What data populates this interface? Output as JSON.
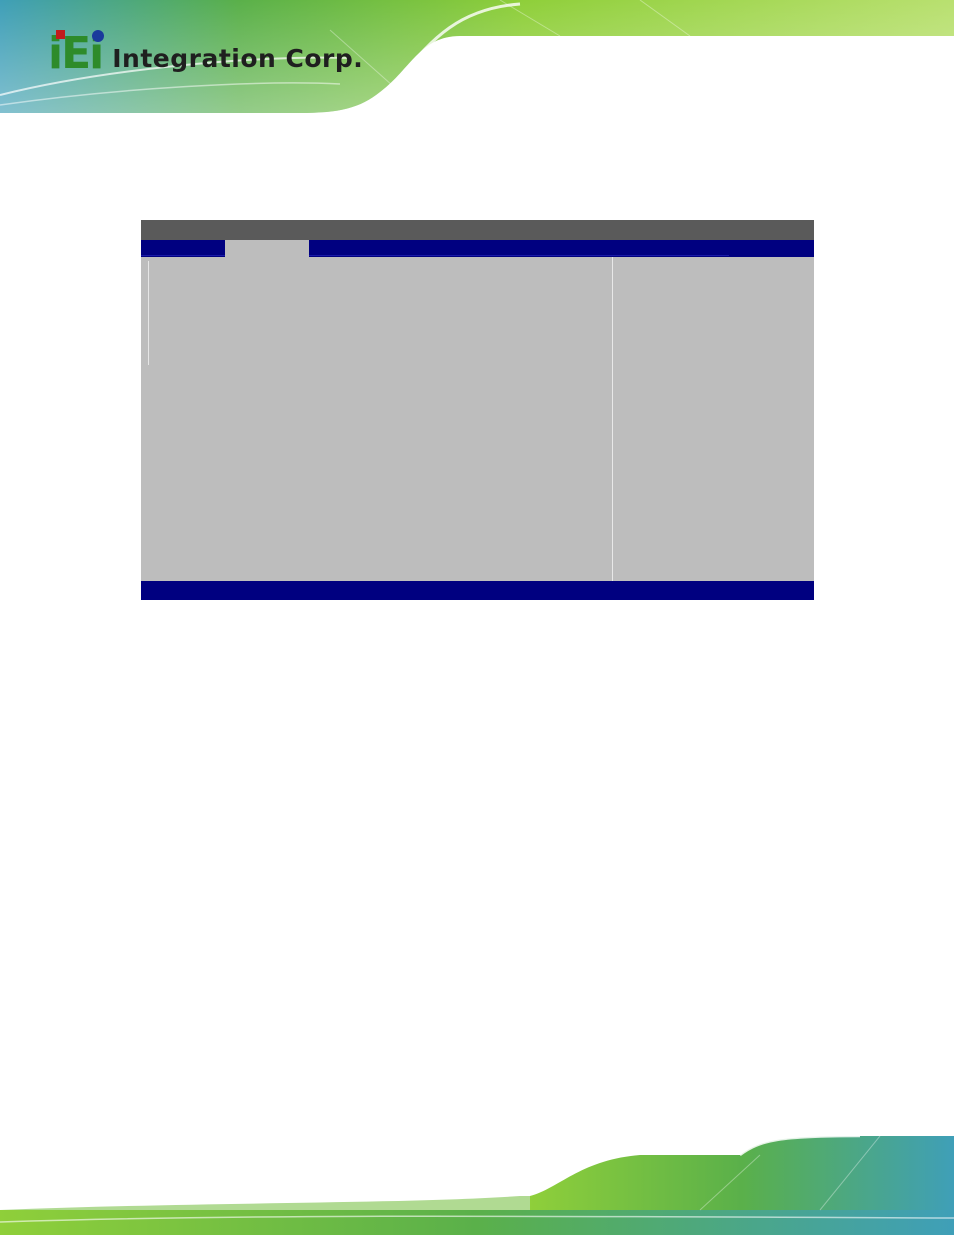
{
  "brand": {
    "logo_mark": "iEi",
    "company_name": "Integration Corp."
  },
  "bios": {
    "title": "",
    "tabs": [
      {
        "label": "",
        "active": false
      },
      {
        "label": "",
        "active": true
      },
      {
        "label": "",
        "active": false
      },
      {
        "label": "",
        "active": false
      },
      {
        "label": "",
        "active": false
      },
      {
        "label": "",
        "active": false
      },
      {
        "label": "",
        "active": false
      }
    ],
    "status": ""
  },
  "colors": {
    "menu_blue": "#000080",
    "title_gray": "#5a5a5a",
    "panel_gray": "#bdbdbd",
    "brand_green": "#2e8b2a"
  }
}
